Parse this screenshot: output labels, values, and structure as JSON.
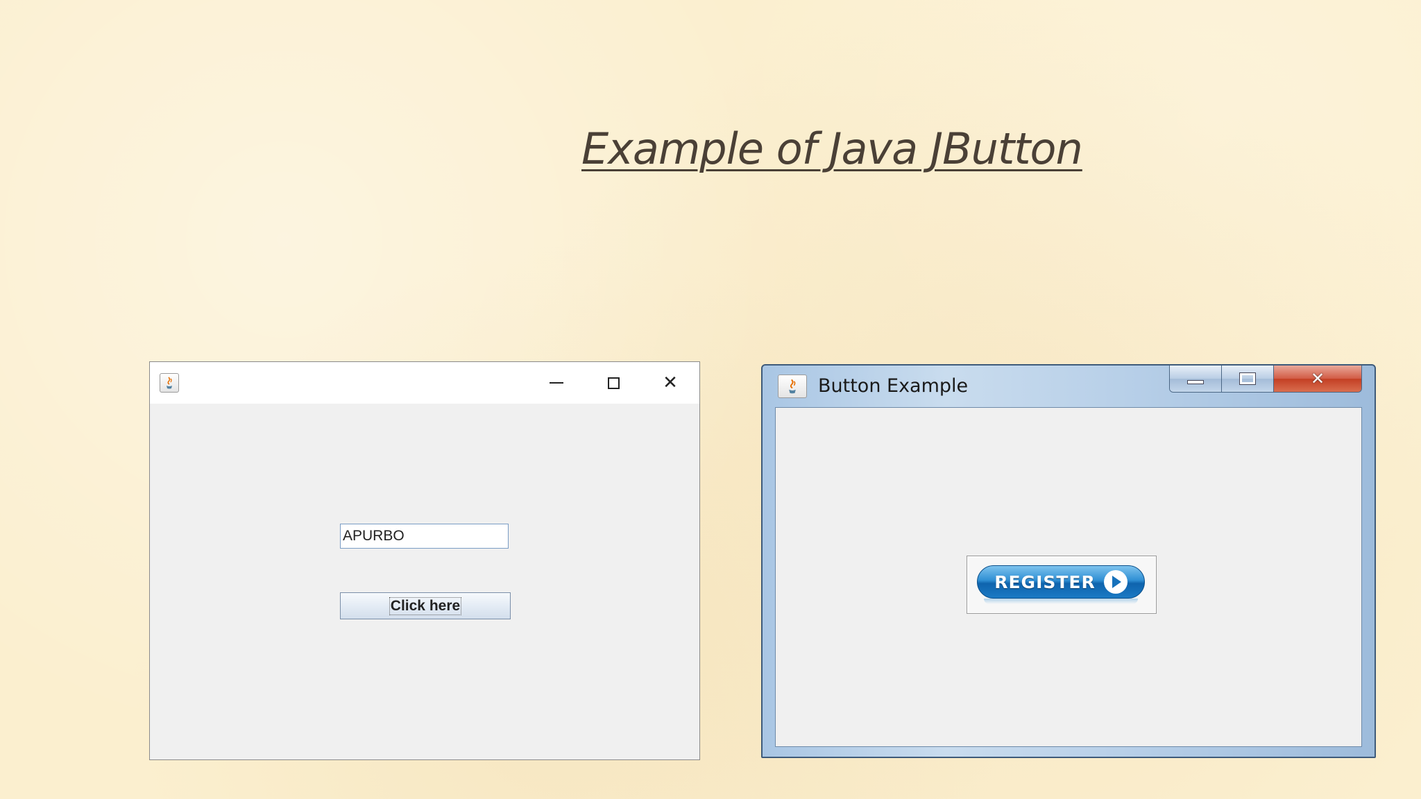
{
  "slide": {
    "title": "Example of Java JButton"
  },
  "window1": {
    "title": "",
    "icon": "java-cup-icon",
    "controls": {
      "minimize": "–",
      "maximize": "☐",
      "close": "✕"
    },
    "textfield_value": "APURBO",
    "button_label": "Click here"
  },
  "window2": {
    "title": "Button Example",
    "icon": "java-cup-icon",
    "controls": {
      "close": "✕"
    },
    "button_label": "REGISTER"
  },
  "colors": {
    "background": "#fbefcf",
    "title_text": "#4a4036",
    "register_blue": "#1a79c4",
    "win7_close_red": "#c33f24"
  }
}
